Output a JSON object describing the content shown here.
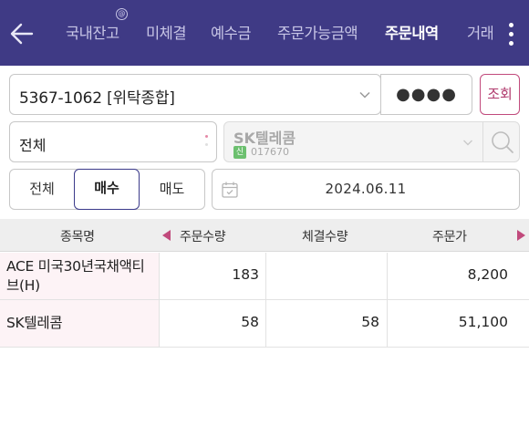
{
  "nav": {
    "tabs": [
      {
        "label": "국내잔고",
        "active": false
      },
      {
        "label": "미체결",
        "active": false
      },
      {
        "label": "예수금",
        "active": false
      },
      {
        "label": "주문가능금액",
        "active": false
      },
      {
        "label": "주문내역",
        "active": true
      },
      {
        "label": "거래",
        "active": false
      }
    ],
    "tab_badge": "@",
    "back_icon": "arrow-left-icon",
    "more_icon": "kebab-menu-icon"
  },
  "form": {
    "account": "5367-1062 [위탁종합]",
    "password_mask": "●●●●",
    "query_label": "조회",
    "scope": "전체",
    "stock": {
      "name": "SK텔레콤",
      "market_badge": "신",
      "code": "017670"
    },
    "order_type": {
      "options": [
        "전체",
        "매수",
        "매도"
      ],
      "selected": "매수"
    },
    "date": "2024.06.11"
  },
  "table": {
    "headers": [
      "종목명",
      "주문수량",
      "체결수량",
      "주문가"
    ],
    "rows": [
      {
        "name": "ACE 미국30년국채액티브(H)",
        "order_qty": "183",
        "filled_qty": "",
        "order_price": "8,200"
      },
      {
        "name": "SK텔레콤",
        "order_qty": "58",
        "filled_qty": "58",
        "order_price": "51,100"
      }
    ]
  },
  "colors": {
    "header_bg": "#3f3a85",
    "accent": "#c14a7c",
    "selected_border": "#3b3a8a"
  }
}
